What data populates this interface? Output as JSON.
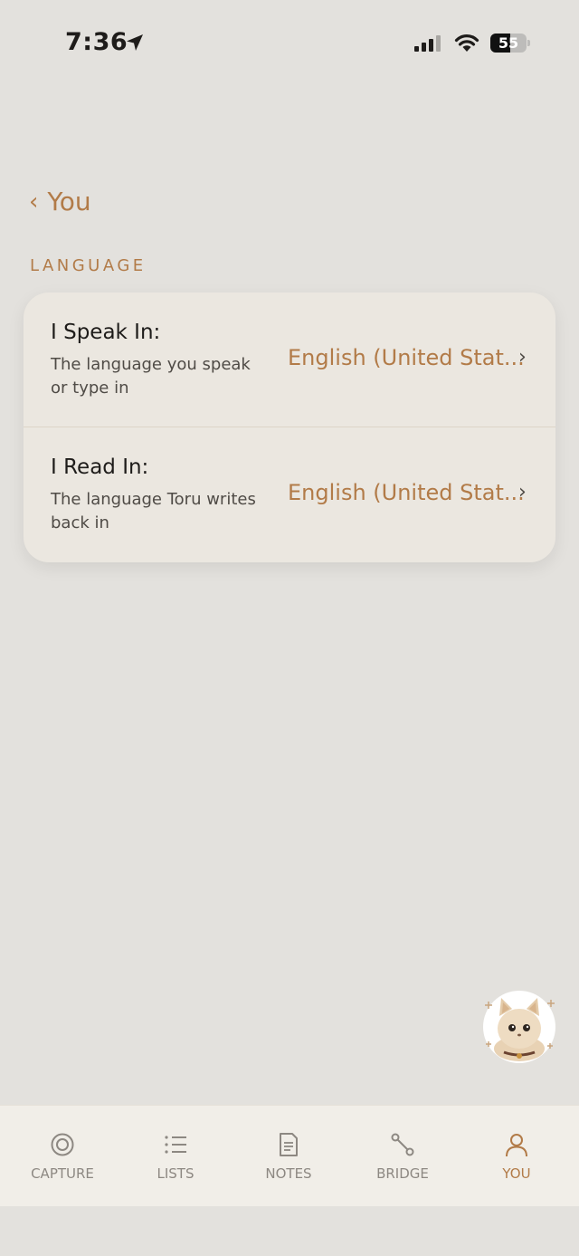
{
  "status_bar": {
    "time": "7:36",
    "battery": "55",
    "battery_level": 0.55
  },
  "nav": {
    "back_label": "You"
  },
  "section": {
    "title": "LANGUAGE"
  },
  "settings": [
    {
      "title": "I Speak In:",
      "description": "The language you speak or type in",
      "value": "English (United Stat..."
    },
    {
      "title": "I Read In:",
      "description": "The language Toru writes back in",
      "value": "English (United Stat..."
    }
  ],
  "tabs": [
    {
      "label": "CAPTURE",
      "icon": "target-icon"
    },
    {
      "label": "LISTS",
      "icon": "list-icon"
    },
    {
      "label": "NOTES",
      "icon": "document-icon"
    },
    {
      "label": "BRIDGE",
      "icon": "bridge-icon"
    },
    {
      "label": "YOU",
      "icon": "person-icon",
      "active": true
    }
  ],
  "colors": {
    "accent": "#b27b48",
    "background": "#e3e1dd",
    "card": "#ebe7e0",
    "tab_inactive": "#8d8882"
  }
}
